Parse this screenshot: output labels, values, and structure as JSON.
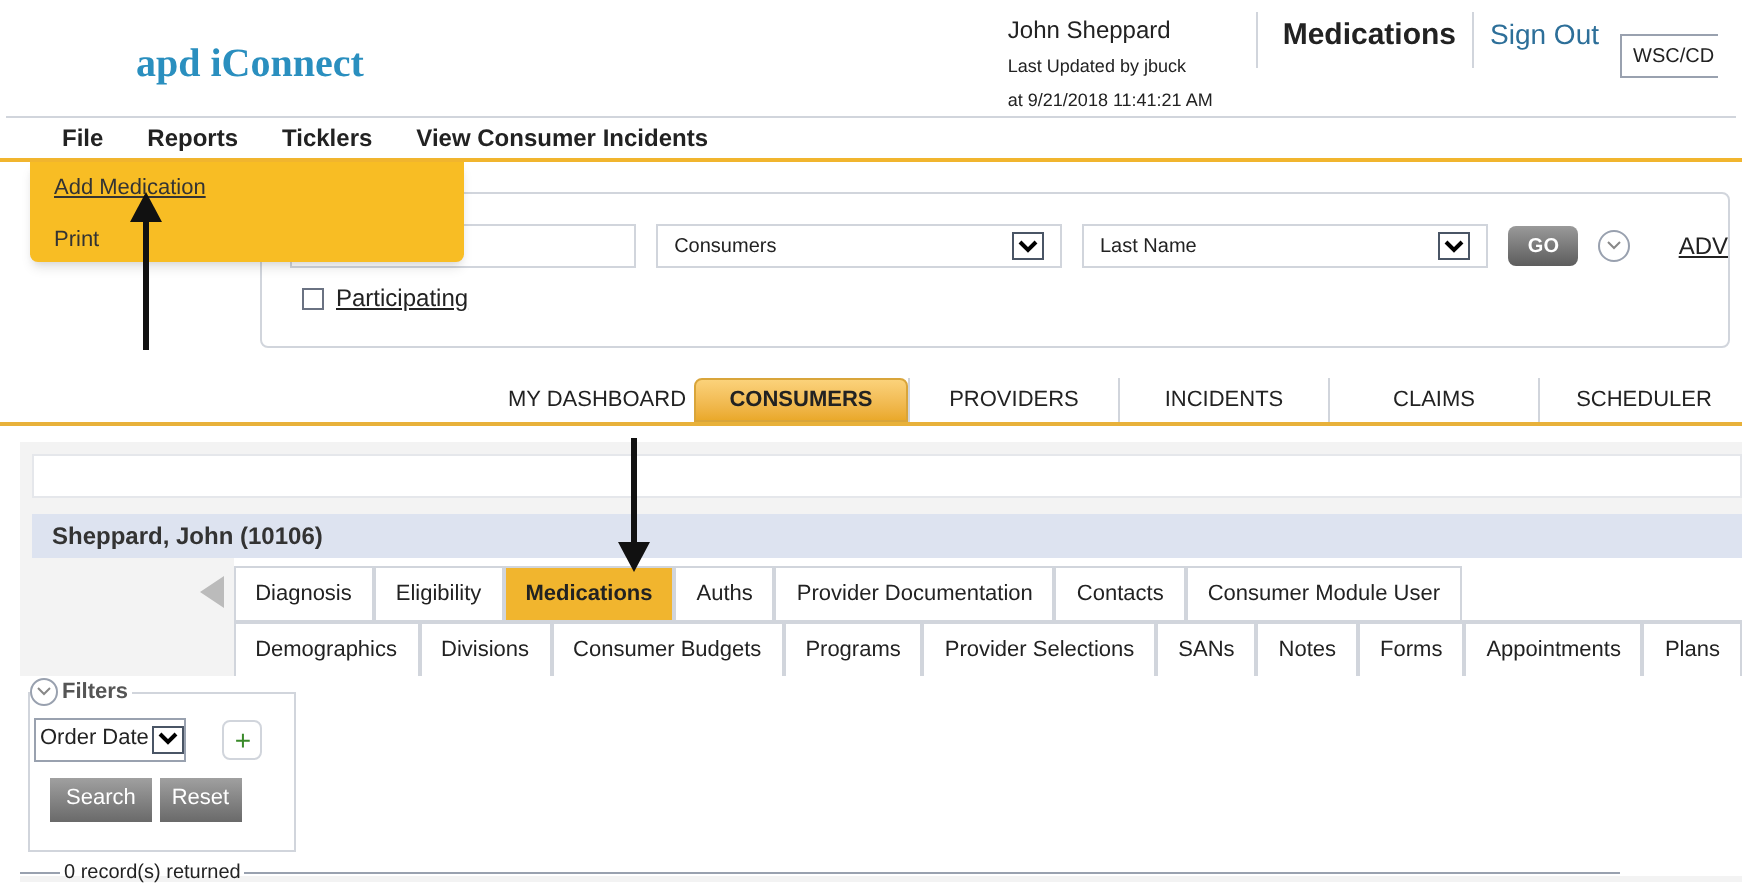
{
  "header": {
    "logo_text": "apd iConnect",
    "user_name": "John Sheppard",
    "updated_by": "Last Updated by jbuck",
    "updated_at": "at 9/21/2018 11:41:21 AM",
    "page_title": "Medications",
    "sign_out": "Sign Out",
    "role_value": "WSC/CD"
  },
  "menu": [
    "File",
    "Reports",
    "Ticklers",
    "View Consumer Incidents"
  ],
  "dropdown": {
    "items": [
      "Add Medication",
      "Print"
    ]
  },
  "search": {
    "type_value": "Consumers",
    "field_value": "Last Name",
    "go": "GO",
    "participating": {
      "label": "Participating",
      "checked": false
    },
    "advanced": "ADV"
  },
  "main_tabs": [
    {
      "label": "MY DASHBOARD",
      "selected": false
    },
    {
      "label": "CONSUMERS",
      "selected": true
    },
    {
      "label": "PROVIDERS",
      "selected": false
    },
    {
      "label": "INCIDENTS",
      "selected": false
    },
    {
      "label": "CLAIMS",
      "selected": false
    },
    {
      "label": "SCHEDULER",
      "selected": false
    }
  ],
  "consumer": {
    "name": "Sheppard, John (10106)"
  },
  "sub_tabs_row1": [
    {
      "label": "Diagnosis",
      "selected": false
    },
    {
      "label": "Eligibility",
      "selected": false
    },
    {
      "label": "Medications",
      "selected": true
    },
    {
      "label": "Auths",
      "selected": false
    },
    {
      "label": "Provider Documentation",
      "selected": false
    },
    {
      "label": "Contacts",
      "selected": false
    },
    {
      "label": "Consumer Module User",
      "selected": false
    }
  ],
  "sub_tabs_row2": [
    {
      "label": "Demographics",
      "selected": false
    },
    {
      "label": "Divisions",
      "selected": false
    },
    {
      "label": "Consumer Budgets",
      "selected": false
    },
    {
      "label": "Programs",
      "selected": false
    },
    {
      "label": "Provider Selections",
      "selected": false
    },
    {
      "label": "SANs",
      "selected": false
    },
    {
      "label": "Notes",
      "selected": false
    },
    {
      "label": "Forms",
      "selected": false
    },
    {
      "label": "Appointments",
      "selected": false
    },
    {
      "label": "Plans",
      "selected": false
    }
  ],
  "filters": {
    "title": "Filters",
    "field_value": "Order Date",
    "add": "+",
    "search": "Search",
    "reset": "Reset"
  },
  "records": "0 record(s) returned"
}
